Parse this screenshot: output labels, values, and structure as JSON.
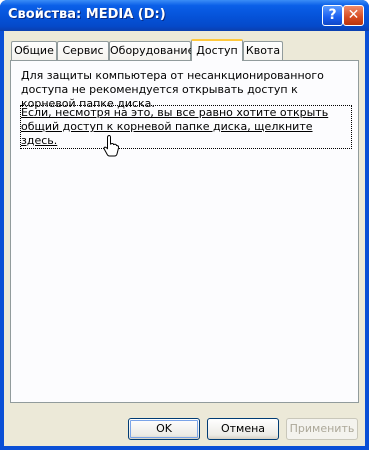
{
  "window": {
    "title": "Свойства: MEDIA (D:)"
  },
  "title_buttons": {
    "help": "?",
    "close": "✕"
  },
  "tabs": [
    {
      "label": "Общие"
    },
    {
      "label": "Сервис"
    },
    {
      "label": "Оборудование"
    },
    {
      "label": "Доступ",
      "active": true
    },
    {
      "label": "Квота"
    }
  ],
  "sharing": {
    "warning": "Для защиты компьютера от несанкционированного доступа не рекомендуется открывать доступ к корневой папке диска.",
    "link": "Если, несмотря на это, вы все равно хотите открыть общий доступ к корневой папке диска, щелкните здесь."
  },
  "buttons": {
    "ok": "OK",
    "cancel": "Отмена",
    "apply": "Применить"
  },
  "colors": {
    "title_bar": "#0552d8",
    "dialog_bg": "#ece9d8",
    "active_tab_highlight": "#ffc83c",
    "close_button": "#d64b20"
  }
}
